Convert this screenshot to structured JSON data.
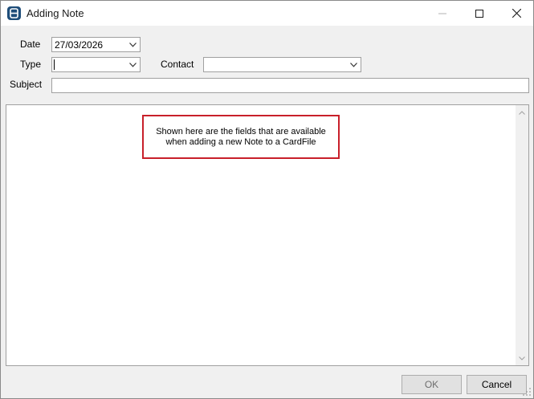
{
  "window": {
    "title": "Adding Note",
    "app_icon": "app-logo-icon",
    "controls": [
      "minimize-icon",
      "maximize-icon",
      "close-icon"
    ]
  },
  "form": {
    "date_label": "Date",
    "date_value": "27/03/2026",
    "type_label": "Type",
    "type_value": "",
    "contact_label": "Contact",
    "contact_value": "",
    "subject_label": "Subject",
    "subject_value": ""
  },
  "callout": {
    "line1": "Shown here are the fields that are available",
    "line2": "when adding a new Note to a CardFile"
  },
  "buttons": {
    "ok_label": "OK",
    "cancel_label": "Cancel"
  },
  "colors": {
    "callout_border": "#c8202a",
    "app_icon": "#1f4e7a"
  }
}
